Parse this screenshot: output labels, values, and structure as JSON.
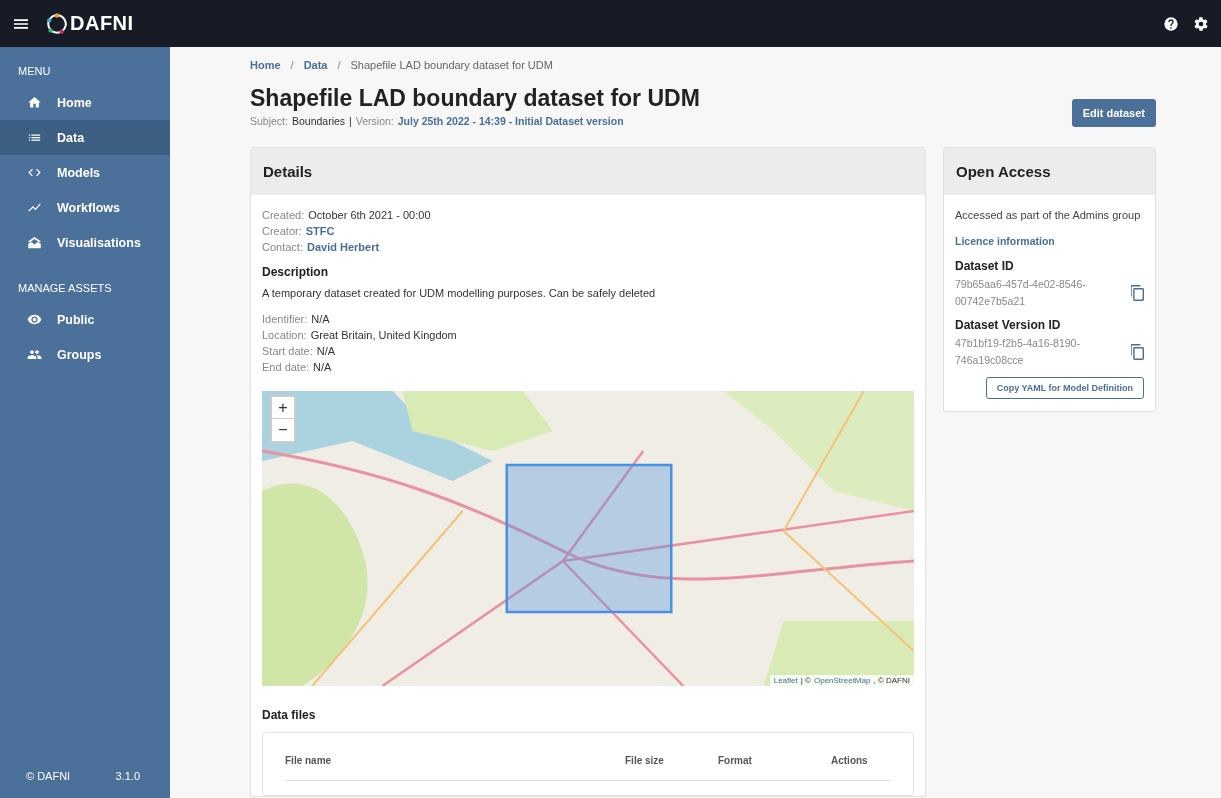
{
  "topbar": {
    "logo": "DAFNI"
  },
  "sidebar": {
    "sections": [
      {
        "heading": "MENU",
        "items": [
          {
            "label": "Home",
            "kind": "home",
            "selected": false
          },
          {
            "label": "Data",
            "kind": "list",
            "selected": true
          },
          {
            "label": "Models",
            "kind": "code",
            "selected": false
          },
          {
            "label": "Workflows",
            "kind": "trend",
            "selected": false
          },
          {
            "label": "Visualisations",
            "kind": "chart",
            "selected": false
          }
        ]
      },
      {
        "heading": "MANAGE ASSETS",
        "items": [
          {
            "label": "Public",
            "kind": "eye",
            "selected": false
          },
          {
            "label": "Groups",
            "kind": "people",
            "selected": false
          }
        ]
      }
    ],
    "footer": {
      "copyright": "© DAFNI",
      "version": "3.1.0"
    }
  },
  "breadcrumb": [
    {
      "label": "Home",
      "kind": "link"
    },
    {
      "label": "/",
      "kind": "separator"
    },
    {
      "label": "Data",
      "kind": "link"
    },
    {
      "label": "/",
      "kind": "separator"
    },
    {
      "label": "Shapefile LAD boundary dataset for UDM",
      "kind": "current"
    }
  ],
  "title": "Shapefile LAD boundary dataset for UDM",
  "subtitle": {
    "subject_label": "Subject:",
    "subject": "Boundaries",
    "separator": "|",
    "version_label": "Version:",
    "version": "July 25th 2022 - 14:39 - Initial Dataset version"
  },
  "edit_button": "Edit dataset",
  "details": {
    "title": "Details",
    "meta": [
      {
        "label": "Created:",
        "value": "October 6th 2021 - 00:00",
        "kind": "text"
      },
      {
        "label": "Creator:",
        "value": "STFC",
        "kind": "link"
      },
      {
        "label": "Contact:",
        "value": "David Herbert",
        "kind": "link"
      }
    ],
    "description_heading": "Description",
    "description": "A temporary dataset created for UDM modelling purposes. Can be safely deleted",
    "meta2": [
      {
        "label": "Identifier:",
        "value": "N/A"
      },
      {
        "label": "Location:",
        "value": "Great Britain, United Kingdom"
      },
      {
        "label": "Start date:",
        "value": "N/A"
      },
      {
        "label": "End date:",
        "value": "N/A"
      }
    ],
    "map": {
      "zoom_in": "+",
      "zoom_out": "−",
      "attribution": [
        {
          "text": "Leaflet",
          "kind": "link"
        },
        {
          "text": "| ©",
          "kind": "text"
        },
        {
          "text": "OpenStreetMap",
          "kind": "link"
        },
        {
          "text": ", © DAFNI",
          "kind": "text"
        }
      ]
    }
  },
  "data_files": {
    "title": "Data files",
    "columns": [
      "File name",
      "File size",
      "Format",
      "Actions"
    ]
  },
  "access": {
    "title": "Open Access",
    "note": "Accessed as part of the Admins group",
    "licence_link": "Licence information",
    "ids": [
      {
        "label": "Dataset ID",
        "value": "79b65aa6-457d-4e02-8546-00742e7b5a21"
      },
      {
        "label": "Dataset Version ID",
        "value": "47b1bf19-f2b5-4a16-8190-746a19c08cce"
      }
    ],
    "yaml_button": "Copy YAML for Model Definition"
  }
}
